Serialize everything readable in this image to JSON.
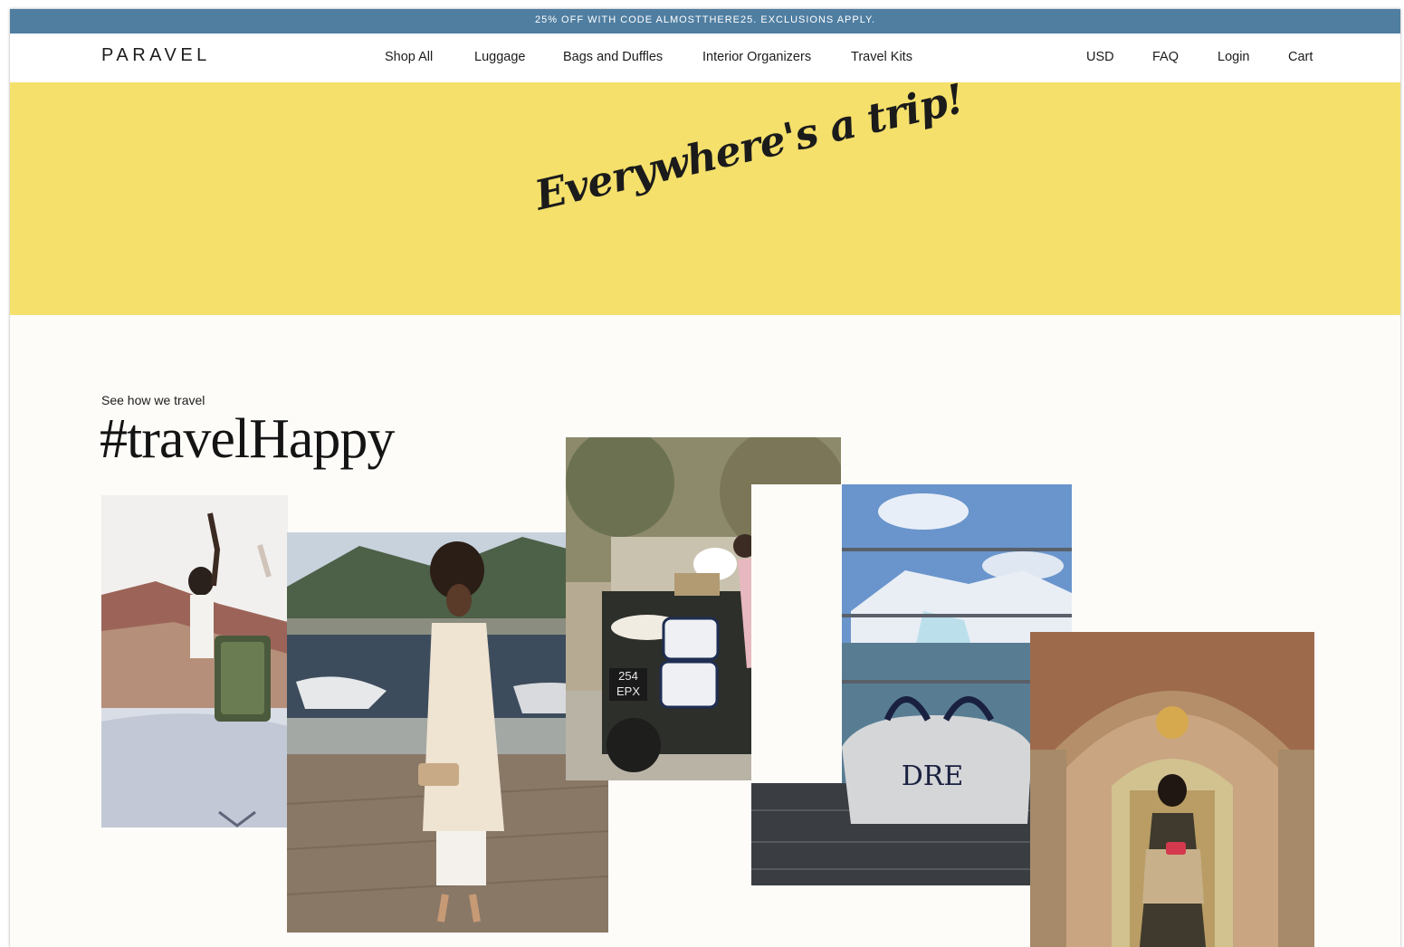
{
  "promo_banner": "25% OFF WITH CODE ALMOSTTHERE25. EXCLUSIONS APPLY.",
  "header": {
    "logo": "PARAVEL",
    "nav": [
      "Shop All",
      "Luggage",
      "Bags and Duffles",
      "Interior Organizers",
      "Travel Kits"
    ],
    "utility": [
      "USD",
      "FAQ",
      "Login",
      "Cart"
    ]
  },
  "hero": {
    "headline": "Everywhere's a trip!"
  },
  "gallery": {
    "kicker": "See how we travel",
    "hashtag": "#travelHappy",
    "photos": [
      {
        "name": "photo-desert-convertible"
      },
      {
        "name": "photo-lake-trenchcoat"
      },
      {
        "name": "photo-land-rover",
        "plate": "254 EPX"
      },
      {
        "name": "photo-glacier-duffle",
        "monogram": "DRE"
      },
      {
        "name": "photo-palace-doorway"
      }
    ]
  },
  "colors": {
    "promo": "#4f7ea1",
    "hero": "#f4e06b",
    "background": "#fdfcf9"
  }
}
